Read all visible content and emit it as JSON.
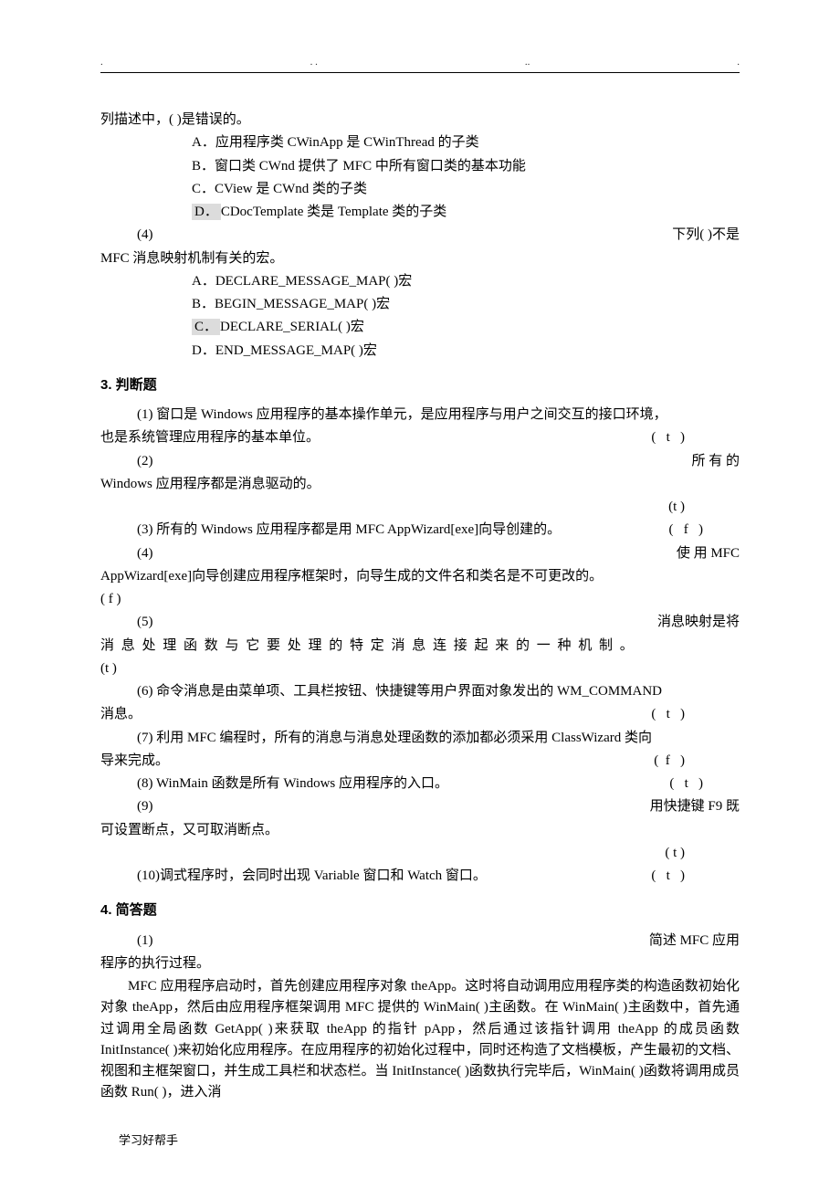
{
  "header": {
    "dots": [
      ".",
      ". .",
      "..",
      "."
    ]
  },
  "q3_intro": {
    "text": "列描述中，(       )是错误的。"
  },
  "q3_options": {
    "a": "A．应用程序类 CWinApp 是 CWinThread 的子类",
    "b": "B．窗口类 CWnd 提供了 MFC 中所有窗口类的基本功能",
    "c": "C．CView 是 CWnd 类的子类",
    "d_prefix": "D．",
    "d_text": "CDocTemplate 类是 Template 类的子类"
  },
  "q4_left": "(4)",
  "q4_right": "下列(     )不是",
  "q4_cont": "MFC 消息映射机制有关的宏。",
  "q4_options": {
    "a": "A．DECLARE_MESSAGE_MAP( )宏",
    "b": "B．BEGIN_MESSAGE_MAP( )宏",
    "c_prefix": "C．",
    "c_text": "DECLARE_SERIAL( )宏",
    "d": "D．END_MESSAGE_MAP( )宏"
  },
  "section3_title": "3. 判断题",
  "j1_line1": "(1) 窗口是 Windows 应用程序的基本操作单元，是应用程序与用户之间交互的接口环境，",
  "j1_line2_text": "也是系统管理应用程序的基本单位。",
  "j1_mark": "(   t   )",
  "j2_left": "(2)",
  "j2_right": "所   有   的",
  "j2_cont": "Windows 应用程序都是消息驱动的。",
  "j2_mark": "(t   )",
  "j3_text": "(3) 所有的 Windows 应用程序都是用 MFC AppWizard[exe]向导创建的。",
  "j3_mark": "(   f   )",
  "j4_left": "(4)",
  "j4_right": "使    用    MFC",
  "j4_cont": "AppWizard[exe]向导创建应用程序框架时，向导生成的文件名和类名是不可更改的。",
  "j4_mark": "( f    )",
  "j5_left": "(5)",
  "j5_right": "消息映射是将",
  "j5_cont": "消 息 处 理 函 数 与 它 要 处 理 的 特 定 消 息 连 接 起 来 的 一 种 机 制 。",
  "j5_mark": "(t  )",
  "j6_line1": "(6) 命令消息是由菜单项、工具栏按钮、快捷键等用户界面对象发出的 WM_COMMAND",
  "j6_line2_text": "消息。",
  "j6_mark": "(   t   )",
  "j7_line1": "(7) 利用 MFC 编程时，所有的消息与消息处理函数的添加都必须采用 ClassWizard 类向",
  "j7_line2_text": "导来完成。",
  "j7_mark": "(  f   )",
  "j8_text": "(8) WinMain 函数是所有 Windows 应用程序的入口。",
  "j8_mark": "(   t   )",
  "j9_left": "(9)",
  "j9_right": "用快捷键 F9 既",
  "j9_cont": "可设置断点，又可取消断点。",
  "j9_mark": "(   t   )",
  "j10_text": "(10)调式程序时，会同时出现 Variable 窗口和 Watch 窗口。",
  "j10_mark": "(   t   )",
  "section4_title": "4. 简答题",
  "sq1_left": "(1)",
  "sq1_right": "简述 MFC 应用",
  "sq1_cont": "程序的执行过程。",
  "answer": {
    "p1": "MFC 应用程序启动时，首先创建应用程序对象 theApp。这时将自动调用应用程序类的构造函数初始化对象 theApp，然后由应用程序框架调用 MFC 提供的 WinMain( )主函数。在 WinMain( )主函数中，首先通过调用全局函数 GetApp( )来获取 theApp 的指针 pApp，然后通过该指针调用 theApp 的成员函数 InitInstance( )来初始化应用程序。在应用程序的初始化过程中，同时还构造了文档模板，产生最初的文档、视图和主框架窗口，并生成工具栏和状态栏。当 InitInstance( )函数执行完毕后，WinMain( )函数将调用成员函数 Run( )，进入消"
  },
  "footer": "学习好帮手"
}
